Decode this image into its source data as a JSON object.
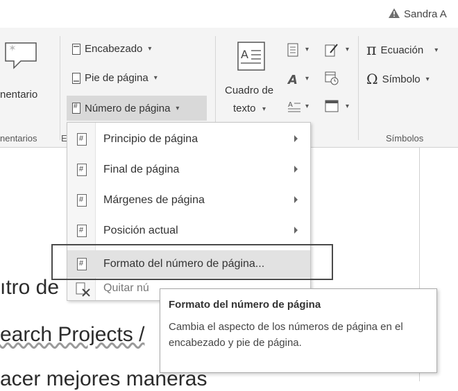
{
  "user": {
    "name": "Sandra A",
    "icon": "warning-icon"
  },
  "ribbon": {
    "comments_group": {
      "button_label": "nentario",
      "group_label": "nentarios"
    },
    "header_footer_group": {
      "items": [
        {
          "label": "Encabezado",
          "icon": "header-icon"
        },
        {
          "label": "Pie de página",
          "icon": "footer-icon"
        },
        {
          "label": "Número de página",
          "icon": "page-number-icon"
        }
      ],
      "group_label_fragment": "E"
    },
    "text_group": {
      "textbox_line1": "Cuadro de",
      "textbox_line2": "texto"
    },
    "symbols_group": {
      "equation_label": "Ecuación",
      "equation_glyph": "π",
      "symbol_label": "Símbolo",
      "symbol_glyph": "Ω",
      "group_label": "Símbolos"
    }
  },
  "menu": {
    "items": [
      {
        "label": "Principio de página",
        "submenu": true
      },
      {
        "label": "Final de página",
        "submenu": true
      },
      {
        "label": "Márgenes de página",
        "submenu": true
      },
      {
        "label": "Posición actual",
        "submenu": true
      },
      {
        "label": "Formato del número de página...",
        "submenu": false,
        "highlighted": true
      },
      {
        "label": "Quitar nú",
        "submenu": false
      }
    ]
  },
  "tooltip": {
    "title": "Formato del número de página",
    "body": "Cambia el aspecto de los números de página en el encabezado y pie de página."
  },
  "document": {
    "line1": "ıtro de",
    "line2": "earch Projects /",
    "line3": "acer mejores maneras"
  },
  "colors": {
    "ribbon_bg": "#f4f4f4",
    "highlight": "#e2e2e2",
    "accent_warning": "#c9a227"
  }
}
